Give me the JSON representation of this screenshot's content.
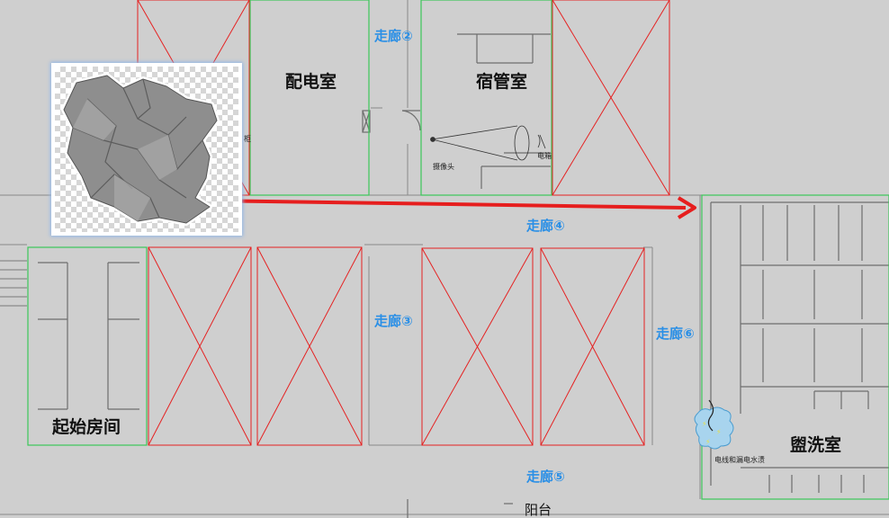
{
  "corridors": {
    "c2": "走廊②",
    "c3": "走廊③",
    "c4": "走廊④",
    "c5": "走廊⑤",
    "c6": "走廊⑥"
  },
  "rooms": {
    "distribution": "配电室",
    "dorm_manager": "宿管室",
    "start_room": "起始房间",
    "washroom": "盥洗室",
    "balcony": "阳台"
  },
  "annotations": {
    "camera": "摄像头",
    "electric_box": "电箱",
    "cabinet": "柜",
    "wire_water": "电线和漏电水渍"
  },
  "item": {
    "name": "crumpled-paper",
    "icon": "crumpled-paper-icon"
  },
  "colors": {
    "accessible_room_border": "#3cc85a",
    "locked_room_border": "#e52222",
    "route_arrow": "#e61e1e",
    "corridor_label": "#2a8fe6",
    "hazard_fill": "#a8d4ee"
  }
}
